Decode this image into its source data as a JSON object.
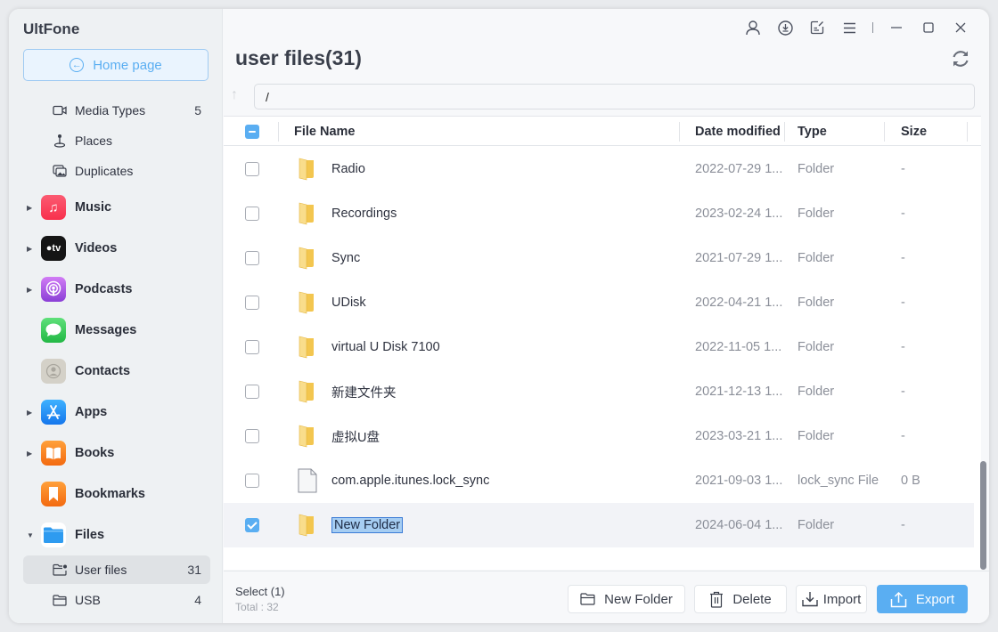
{
  "app": {
    "brand": "UltFone"
  },
  "sidebar": {
    "home_label": "Home page",
    "sub_items_top": [
      {
        "label": "Media Types",
        "count": "5",
        "icon": "video-camera-icon"
      },
      {
        "label": "Places",
        "count": "",
        "icon": "map-pin-icon"
      },
      {
        "label": "Duplicates",
        "count": "",
        "icon": "duplicate-photos-icon"
      }
    ],
    "categories": [
      {
        "label": "Music",
        "expandable": true,
        "expanded": false,
        "icon": "music-app-icon",
        "color": "#fb3c58"
      },
      {
        "label": "Videos",
        "expandable": true,
        "expanded": false,
        "icon": "apple-tv-app-icon",
        "color": "#1c1c1e"
      },
      {
        "label": "Podcasts",
        "expandable": true,
        "expanded": false,
        "icon": "podcasts-app-icon",
        "color": "#9b4ee0"
      },
      {
        "label": "Messages",
        "expandable": false,
        "expanded": false,
        "icon": "messages-app-icon",
        "color": "#33c759"
      },
      {
        "label": "Contacts",
        "expandable": false,
        "expanded": false,
        "icon": "contacts-app-icon",
        "color": "#cfcdc4"
      },
      {
        "label": "Apps",
        "expandable": true,
        "expanded": false,
        "icon": "app-store-icon",
        "color": "#1e8ff6"
      },
      {
        "label": "Books",
        "expandable": true,
        "expanded": false,
        "icon": "books-app-icon",
        "color": "#f7881c"
      },
      {
        "label": "Bookmarks",
        "expandable": false,
        "expanded": false,
        "icon": "bookmarks-app-icon",
        "color": "#f7881c"
      },
      {
        "label": "Files",
        "expandable": true,
        "expanded": true,
        "icon": "files-app-icon",
        "color": "#2e9bf0"
      }
    ],
    "files_sub_items": [
      {
        "label": "User files",
        "count": "31",
        "active": true,
        "icon": "user-folder-icon"
      },
      {
        "label": "USB",
        "count": "4",
        "active": false,
        "icon": "folder-icon"
      }
    ]
  },
  "header": {
    "title": "user files(31)",
    "path_value": "/",
    "window_icons": [
      "user-icon",
      "download-icon",
      "feedback-icon",
      "menu-icon",
      "minimize-icon",
      "maximize-icon",
      "close-icon"
    ]
  },
  "table": {
    "columns": [
      "File Name",
      "Date modified",
      "Type",
      "Size"
    ],
    "rows": [
      {
        "name": "Radio",
        "date": "2022-07-29 1...",
        "type": "Folder",
        "size": "-",
        "kind": "folder",
        "checked": false
      },
      {
        "name": "Recordings",
        "date": "2023-02-24 1...",
        "type": "Folder",
        "size": "-",
        "kind": "folder",
        "checked": false
      },
      {
        "name": "Sync",
        "date": "2021-07-29 1...",
        "type": "Folder",
        "size": "-",
        "kind": "folder",
        "checked": false
      },
      {
        "name": "UDisk",
        "date": "2022-04-21 1...",
        "type": "Folder",
        "size": "-",
        "kind": "folder",
        "checked": false
      },
      {
        "name": "virtual U Disk 7100",
        "date": "2022-11-05 1...",
        "type": "Folder",
        "size": "-",
        "kind": "folder",
        "checked": false
      },
      {
        "name": "新建文件夹",
        "date": "2021-12-13 1...",
        "type": "Folder",
        "size": "-",
        "kind": "folder",
        "checked": false
      },
      {
        "name": "虚拟U盘",
        "date": "2023-03-21 1...",
        "type": "Folder",
        "size": "-",
        "kind": "folder",
        "checked": false
      },
      {
        "name": "com.apple.itunes.lock_sync",
        "date": "2021-09-03 1...",
        "type": "lock_sync File",
        "size": "0 B",
        "kind": "file",
        "checked": false
      },
      {
        "name": "New Folder",
        "date": "2024-06-04 1...",
        "type": "Folder",
        "size": "-",
        "kind": "folder",
        "checked": true,
        "editing": true
      }
    ]
  },
  "footer": {
    "select_text": "Select (1)",
    "total_text": "Total : 32",
    "buttons": {
      "new_folder": "New Folder",
      "delete": "Delete",
      "import": "Import",
      "export": "Export"
    }
  },
  "colors": {
    "accent": "#5aaef2",
    "selected_row": "#f2f3f7",
    "folder": "#f5cf63"
  }
}
